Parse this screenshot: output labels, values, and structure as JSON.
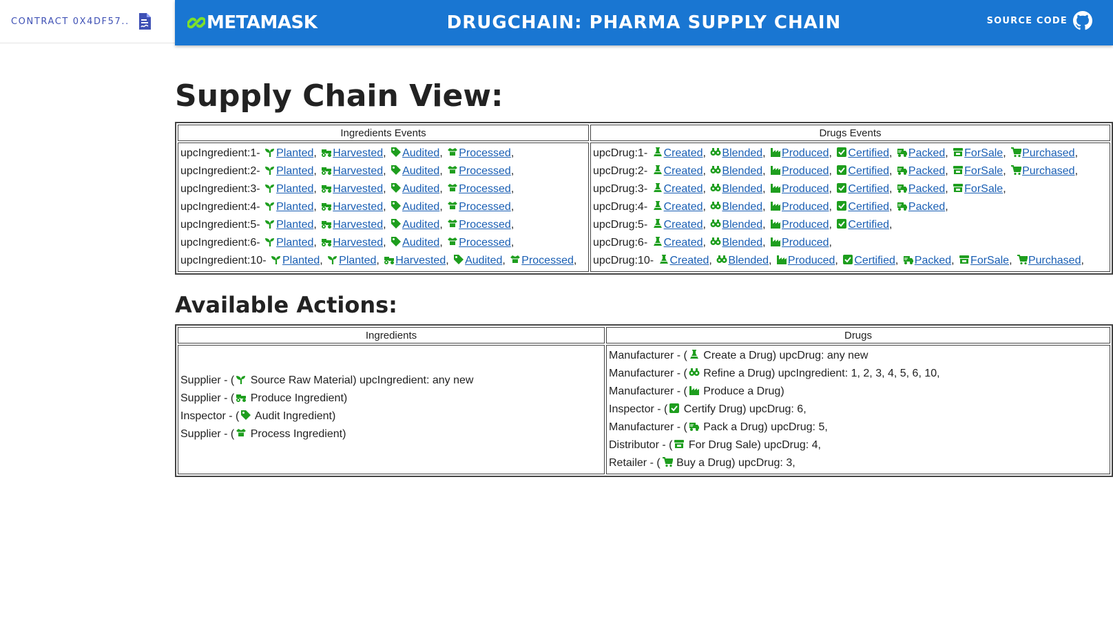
{
  "sidebar": {
    "contract_label": "CONTRACT 0X4DF57.."
  },
  "appbar": {
    "brand": "METAMASK",
    "title": "DRUGCHAIN: PHARMA SUPPLY CHAIN",
    "source_code": "SOURCE CODE"
  },
  "colors": {
    "appbar": "#1976d2",
    "icon_green": "#1e9e1e",
    "link": "#1a5fb4",
    "contract_text": "#3f51b5"
  },
  "supply_chain": {
    "title": "Supply Chain View:",
    "ingredients_header": "Ingredients Events",
    "drugs_header": "Drugs Events",
    "ingredients": [
      {
        "label": "upcIngredient:1-",
        "events": [
          {
            "name": "Planted",
            "icon": "seedling-icon"
          },
          {
            "name": "Harvested",
            "icon": "tractor-icon"
          },
          {
            "name": "Audited",
            "icon": "tag-icon"
          },
          {
            "name": "Processed",
            "icon": "box-open-icon"
          }
        ]
      },
      {
        "label": "upcIngredient:2-",
        "events": [
          {
            "name": "Planted",
            "icon": "seedling-icon"
          },
          {
            "name": "Harvested",
            "icon": "tractor-icon"
          },
          {
            "name": "Audited",
            "icon": "tag-icon"
          },
          {
            "name": "Processed",
            "icon": "box-open-icon"
          }
        ]
      },
      {
        "label": "upcIngredient:3-",
        "events": [
          {
            "name": "Planted",
            "icon": "seedling-icon"
          },
          {
            "name": "Harvested",
            "icon": "tractor-icon"
          },
          {
            "name": "Audited",
            "icon": "tag-icon"
          },
          {
            "name": "Processed",
            "icon": "box-open-icon"
          }
        ]
      },
      {
        "label": "upcIngredient:4-",
        "events": [
          {
            "name": "Planted",
            "icon": "seedling-icon"
          },
          {
            "name": "Harvested",
            "icon": "tractor-icon"
          },
          {
            "name": "Audited",
            "icon": "tag-icon"
          },
          {
            "name": "Processed",
            "icon": "box-open-icon"
          }
        ]
      },
      {
        "label": "upcIngredient:5-",
        "events": [
          {
            "name": "Planted",
            "icon": "seedling-icon"
          },
          {
            "name": "Harvested",
            "icon": "tractor-icon"
          },
          {
            "name": "Audited",
            "icon": "tag-icon"
          },
          {
            "name": "Processed",
            "icon": "box-open-icon"
          }
        ]
      },
      {
        "label": "upcIngredient:6-",
        "events": [
          {
            "name": "Planted",
            "icon": "seedling-icon"
          },
          {
            "name": "Harvested",
            "icon": "tractor-icon"
          },
          {
            "name": "Audited",
            "icon": "tag-icon"
          },
          {
            "name": "Processed",
            "icon": "box-open-icon"
          }
        ]
      },
      {
        "label": "upcIngredient:10-",
        "events": [
          {
            "name": "Planted",
            "icon": "seedling-icon"
          },
          {
            "name": "Planted",
            "icon": "seedling-icon"
          },
          {
            "name": "Harvested",
            "icon": "tractor-icon"
          },
          {
            "name": "Audited",
            "icon": "tag-icon"
          },
          {
            "name": "Processed",
            "icon": "box-open-icon"
          }
        ]
      }
    ],
    "drugs": [
      {
        "label": "upcDrug:1-",
        "events": [
          {
            "name": "Created",
            "icon": "flask-icon"
          },
          {
            "name": "Blended",
            "icon": "blend-icon"
          },
          {
            "name": "Produced",
            "icon": "industry-icon"
          },
          {
            "name": "Certified",
            "icon": "check-square-icon"
          },
          {
            "name": "Packed",
            "icon": "truck-icon"
          },
          {
            "name": "ForSale",
            "icon": "store-icon"
          },
          {
            "name": "Purchased",
            "icon": "cart-icon"
          }
        ]
      },
      {
        "label": "upcDrug:2-",
        "events": [
          {
            "name": "Created",
            "icon": "flask-icon"
          },
          {
            "name": "Blended",
            "icon": "blend-icon"
          },
          {
            "name": "Produced",
            "icon": "industry-icon"
          },
          {
            "name": "Certified",
            "icon": "check-square-icon"
          },
          {
            "name": "Packed",
            "icon": "truck-icon"
          },
          {
            "name": "ForSale",
            "icon": "store-icon"
          },
          {
            "name": "Purchased",
            "icon": "cart-icon"
          }
        ]
      },
      {
        "label": "upcDrug:3-",
        "events": [
          {
            "name": "Created",
            "icon": "flask-icon"
          },
          {
            "name": "Blended",
            "icon": "blend-icon"
          },
          {
            "name": "Produced",
            "icon": "industry-icon"
          },
          {
            "name": "Certified",
            "icon": "check-square-icon"
          },
          {
            "name": "Packed",
            "icon": "truck-icon"
          },
          {
            "name": "ForSale",
            "icon": "store-icon"
          }
        ]
      },
      {
        "label": "upcDrug:4-",
        "events": [
          {
            "name": "Created",
            "icon": "flask-icon"
          },
          {
            "name": "Blended",
            "icon": "blend-icon"
          },
          {
            "name": "Produced",
            "icon": "industry-icon"
          },
          {
            "name": "Certified",
            "icon": "check-square-icon"
          },
          {
            "name": "Packed",
            "icon": "truck-icon"
          }
        ]
      },
      {
        "label": "upcDrug:5-",
        "events": [
          {
            "name": "Created",
            "icon": "flask-icon"
          },
          {
            "name": "Blended",
            "icon": "blend-icon"
          },
          {
            "name": "Produced",
            "icon": "industry-icon"
          },
          {
            "name": "Certified",
            "icon": "check-square-icon"
          }
        ]
      },
      {
        "label": "upcDrug:6-",
        "events": [
          {
            "name": "Created",
            "icon": "flask-icon"
          },
          {
            "name": "Blended",
            "icon": "blend-icon"
          },
          {
            "name": "Produced",
            "icon": "industry-icon"
          }
        ]
      },
      {
        "label": "upcDrug:10-",
        "events": [
          {
            "name": "Created",
            "icon": "flask-icon"
          },
          {
            "name": "Blended",
            "icon": "blend-icon"
          },
          {
            "name": "Produced",
            "icon": "industry-icon"
          },
          {
            "name": "Certified",
            "icon": "check-square-icon"
          },
          {
            "name": "Packed",
            "icon": "truck-icon"
          },
          {
            "name": "ForSale",
            "icon": "store-icon"
          },
          {
            "name": "Purchased",
            "icon": "cart-icon"
          }
        ]
      }
    ]
  },
  "actions": {
    "title": "Available Actions:",
    "ingredients_header": "Ingredients",
    "drugs_header": "Drugs",
    "ingredients": [
      {
        "role": "Supplier",
        "icon": "seedling-icon",
        "action": "Source Raw Material",
        "suffix": "upcIngredient: any new"
      },
      {
        "role": "Supplier",
        "icon": "tractor-icon",
        "action": "Produce Ingredient",
        "suffix": ""
      },
      {
        "role": "Inspector",
        "icon": "tag-icon",
        "action": "Audit Ingredient",
        "suffix": ""
      },
      {
        "role": "Supplier",
        "icon": "box-open-icon",
        "action": "Process Ingredient",
        "suffix": ""
      }
    ],
    "drugs": [
      {
        "role": "Manufacturer",
        "icon": "flask-icon",
        "action": "Create a Drug",
        "suffix": "upcDrug: any new"
      },
      {
        "role": "Manufacturer",
        "icon": "blend-icon",
        "action": "Refine a Drug",
        "suffix": "upcIngredient: 1, 2, 3, 4, 5, 6, 10,"
      },
      {
        "role": "Manufacturer",
        "icon": "industry-icon",
        "action": "Produce a Drug",
        "suffix": ""
      },
      {
        "role": "Inspector",
        "icon": "check-square-icon",
        "action": "Certify Drug",
        "suffix": "upcDrug: 6,"
      },
      {
        "role": "Manufacturer",
        "icon": "truck-icon",
        "action": "Pack a Drug",
        "suffix": "upcDrug: 5,"
      },
      {
        "role": "Distributor",
        "icon": "store-icon",
        "action": "For Drug Sale",
        "suffix": "upcDrug: 4,"
      },
      {
        "role": "Retailer",
        "icon": "cart-icon",
        "action": "Buy a Drug",
        "suffix": "upcDrug: 3,"
      }
    ]
  }
}
